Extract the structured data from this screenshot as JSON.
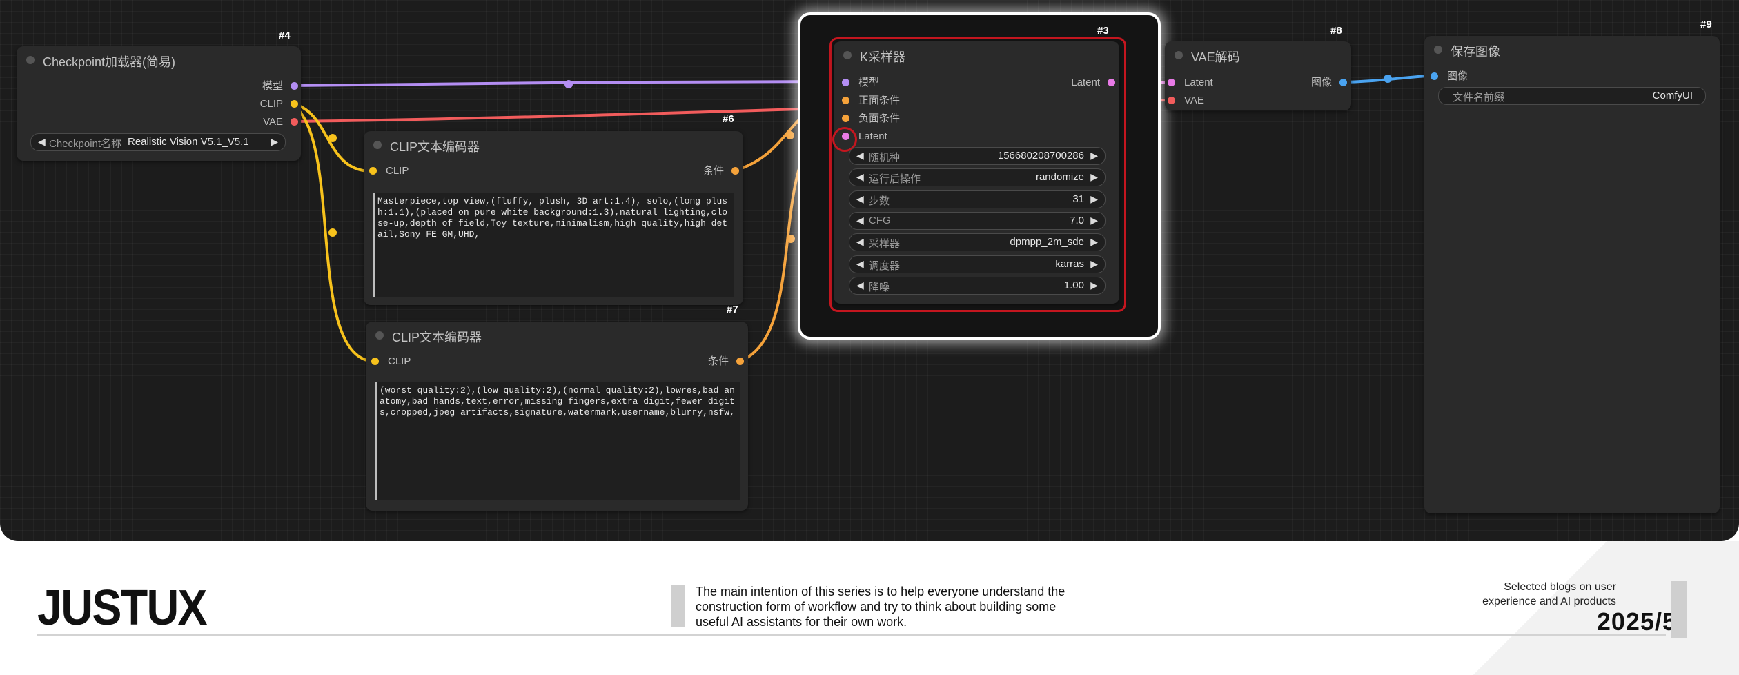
{
  "colors": {
    "model": "#b48ef3",
    "clip": "#f7c21c",
    "vae": "#f25c5c",
    "cond": "#f5a23a",
    "latent": "#e87ae6",
    "image": "#4aa3f0",
    "highlight": "#d11f2a"
  },
  "nodes": {
    "checkpoint": {
      "id": "#4",
      "title": "Checkpoint加载器(简易)",
      "out_model": "模型",
      "out_clip": "CLIP",
      "out_vae": "VAE",
      "widget_label": "Checkpoint名称",
      "widget_value": "Realistic Vision V5.1_V5.1"
    },
    "clip_pos": {
      "id": "#6",
      "title": "CLIP文本编码器",
      "in_clip": "CLIP",
      "out_cond": "条件",
      "text": "Masterpiece,top view,(fluffy, plush, 3D art:1.4), solo,(long plush:1.1),(placed on pure white background:1.3),natural lighting,close-up,depth of field,Toy texture,minimalism,high quality,high detail,Sony FE GM,UHD,"
    },
    "clip_neg": {
      "id": "#7",
      "title": "CLIP文本编码器",
      "in_clip": "CLIP",
      "out_cond": "条件",
      "text": "(worst quality:2),(low quality:2),(normal quality:2),lowres,bad anatomy,bad hands,text,error,missing fingers,extra digit,fewer digits,cropped,jpeg artifacts,signature,watermark,username,blurry,nsfw,"
    },
    "ksampler": {
      "id": "#3",
      "title": "K采样器",
      "in_model": "模型",
      "in_pos": "正面条件",
      "in_neg": "负面条件",
      "in_latent": "Latent",
      "out_latent": "Latent",
      "widgets": [
        {
          "label": "随机种",
          "value": "156680208700286"
        },
        {
          "label": "运行后操作",
          "value": "randomize"
        },
        {
          "label": "步数",
          "value": "31"
        },
        {
          "label": "CFG",
          "value": "7.0"
        },
        {
          "label": "采样器",
          "value": "dpmpp_2m_sde"
        },
        {
          "label": "调度器",
          "value": "karras"
        },
        {
          "label": "降噪",
          "value": "1.00"
        }
      ]
    },
    "vae_decode": {
      "id": "#8",
      "title": "VAE解码",
      "in_latent": "Latent",
      "in_vae": "VAE",
      "out_image": "图像"
    },
    "save_image": {
      "id": "#9",
      "title": "保存图像",
      "in_image": "图像",
      "widget_label": "文件名前缀",
      "widget_value": "ComfyUI"
    }
  },
  "footer": {
    "brand": "JUSTUX",
    "description": "The main intention of this series is to help everyone understand the construction form of workflow and try to think about building some useful AI assistants for their own work.",
    "tagline_line1": "Selected blogs on user",
    "tagline_line2": "experience and AI products",
    "date": "2025/5"
  }
}
